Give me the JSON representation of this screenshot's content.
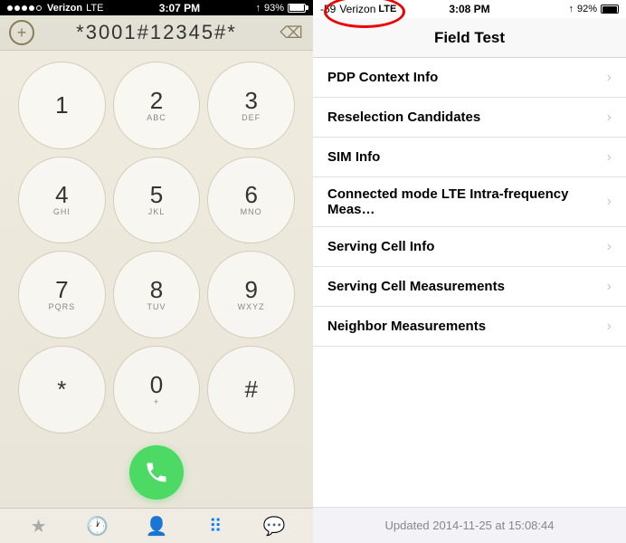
{
  "left": {
    "statusBar": {
      "carrier": "Verizon",
      "network": "LTE",
      "time": "3:07 PM",
      "battery": "93%"
    },
    "dialer": {
      "number": "*3001#12345#*",
      "addLabel": "+",
      "deleteLabel": "⌫"
    },
    "keys": [
      {
        "main": "1",
        "sub": ""
      },
      {
        "main": "2",
        "sub": "ABC"
      },
      {
        "main": "3",
        "sub": "DEF"
      },
      {
        "main": "4",
        "sub": "GHI"
      },
      {
        "main": "5",
        "sub": "JKL"
      },
      {
        "main": "6",
        "sub": "MNO"
      },
      {
        "main": "7",
        "sub": "PQRS"
      },
      {
        "main": "8",
        "sub": "TUV"
      },
      {
        "main": "9",
        "sub": "WXYZ"
      },
      {
        "main": "*",
        "sub": ""
      },
      {
        "main": "0",
        "sub": "+"
      },
      {
        "main": "#",
        "sub": ""
      }
    ],
    "tabs": [
      {
        "icon": "★",
        "name": "favorites",
        "active": false
      },
      {
        "icon": "🕐",
        "name": "recents",
        "active": false
      },
      {
        "icon": "👤",
        "name": "contacts",
        "active": false
      },
      {
        "icon": "⠿",
        "name": "keypad",
        "active": true
      },
      {
        "icon": "💬",
        "name": "voicemail",
        "active": false
      }
    ]
  },
  "right": {
    "statusBar": {
      "signal": "-59",
      "carrier": "Verizon",
      "network": "LTE",
      "time": "3:08 PM",
      "battery": "92%"
    },
    "title": "Field Test",
    "menuItems": [
      {
        "label": "PDP Context Info"
      },
      {
        "label": "Reselection Candidates"
      },
      {
        "label": "SIM Info"
      },
      {
        "label": "Connected mode LTE Intra-frequency Meas…"
      },
      {
        "label": "Serving Cell Info"
      },
      {
        "label": "Serving Cell Measurements"
      },
      {
        "label": "Neighbor Measurements"
      }
    ],
    "footer": "Updated 2014-11-25 at 15:08:44"
  }
}
